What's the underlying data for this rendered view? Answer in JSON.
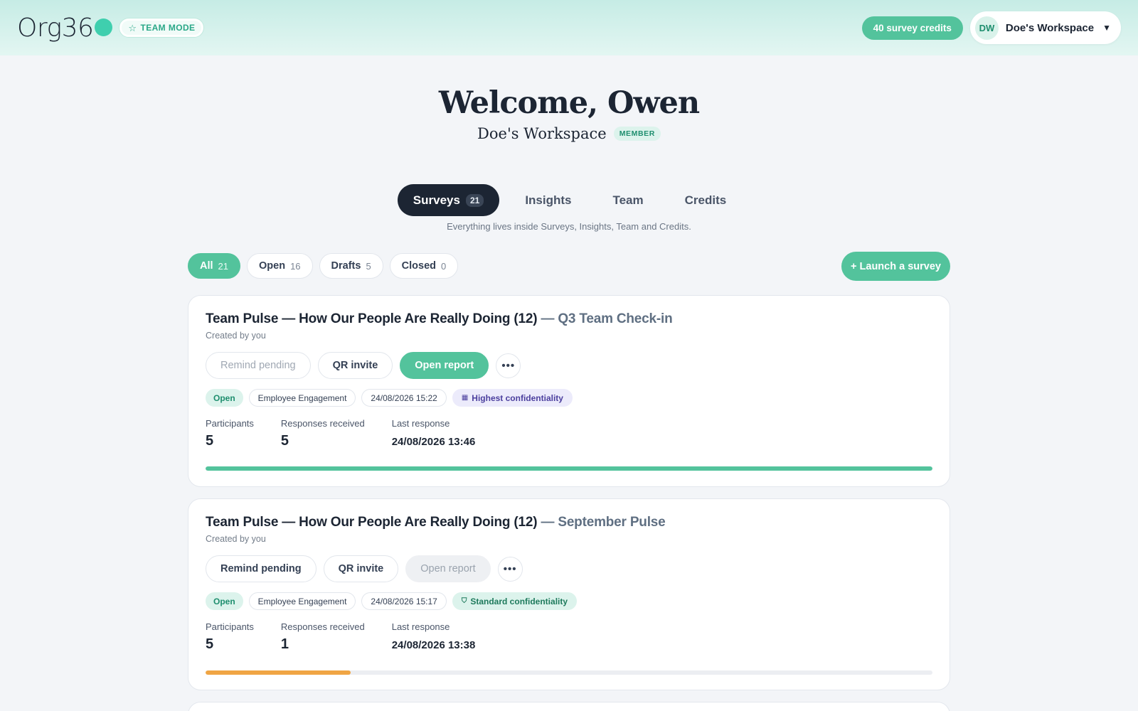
{
  "brand": {
    "logo_text": "Org36",
    "team_mode_label": "TEAM MODE"
  },
  "header": {
    "credits_label": "40 survey credits",
    "workspace_initials": "DW",
    "workspace_name": "Doe's Workspace"
  },
  "welcome": {
    "title": "Welcome, Owen",
    "workspace": "Doe's Workspace",
    "role_badge": "MEMBER"
  },
  "tabs": [
    {
      "label": "Surveys",
      "count": "21",
      "active": true
    },
    {
      "label": "Insights"
    },
    {
      "label": "Team"
    },
    {
      "label": "Credits"
    }
  ],
  "tabs_hint": "Everything lives inside Surveys, Insights, Team and Credits.",
  "filters": [
    {
      "label": "All",
      "count": "21",
      "active": true
    },
    {
      "label": "Open",
      "count": "16"
    },
    {
      "label": "Drafts",
      "count": "5"
    },
    {
      "label": "Closed",
      "count": "0"
    }
  ],
  "launch_label": "+ Launch a survey",
  "stat_labels": {
    "participants": "Participants",
    "responses": "Responses received",
    "last_response": "Last response"
  },
  "actions": {
    "remind": "Remind pending",
    "qr": "QR invite",
    "report": "Open report",
    "more": "•••"
  },
  "surveys": [
    {
      "title": "Team Pulse — How Our People Are Really Doing (12)",
      "separator": " — ",
      "campaign": "Q3 Team Check-in",
      "creator": "Created by you",
      "status": "Open",
      "category": "Employee Engagement",
      "datetime": "24/08/2026 15:22",
      "confidentiality": "Highest confidentiality",
      "participants": "5",
      "responses": "5",
      "last_response": "24/08/2026 13:46",
      "response_rate": 1.0,
      "progress_color": "#53c39c"
    },
    {
      "title": "Team Pulse — How Our People Are Really Doing (12)",
      "separator": " — ",
      "campaign": "September Pulse",
      "creator": "Created by you",
      "status": "Open",
      "category": "Employee Engagement",
      "datetime": "24/08/2026 15:17",
      "confidentiality": "Standard confidentiality",
      "participants": "5",
      "responses": "1",
      "last_response": "24/08/2026 13:38",
      "response_rate": 0.2,
      "progress_color": "#f0a544"
    }
  ],
  "colors": {
    "accent": "#53c39c",
    "dark": "#1c2533",
    "warning": "#f0a544"
  }
}
